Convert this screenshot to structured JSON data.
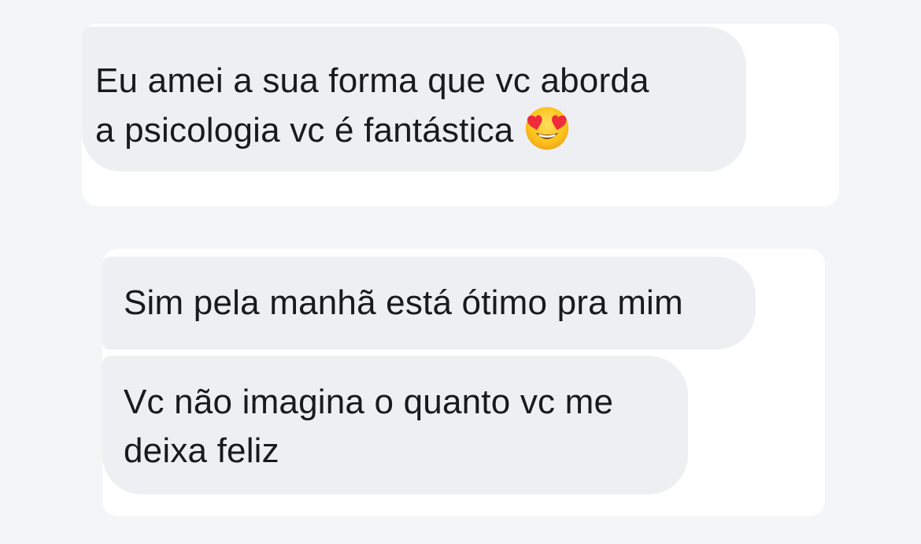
{
  "messages": [
    {
      "lines": [
        "Eu amei a sua forma que vc aborda",
        "a psicologia vc é fantástica"
      ],
      "emoji": "heart-eyes-emoji"
    },
    {
      "lines": [
        "Sim pela manhã está ótimo pra mim"
      ]
    },
    {
      "lines": [
        "Vc não imagina o quanto vc me",
        "deixa feliz"
      ]
    }
  ],
  "colors": {
    "background": "#f4f5f7",
    "card": "#ffffff",
    "bubble": "#eeeff2",
    "text": "#1a1a1c"
  }
}
